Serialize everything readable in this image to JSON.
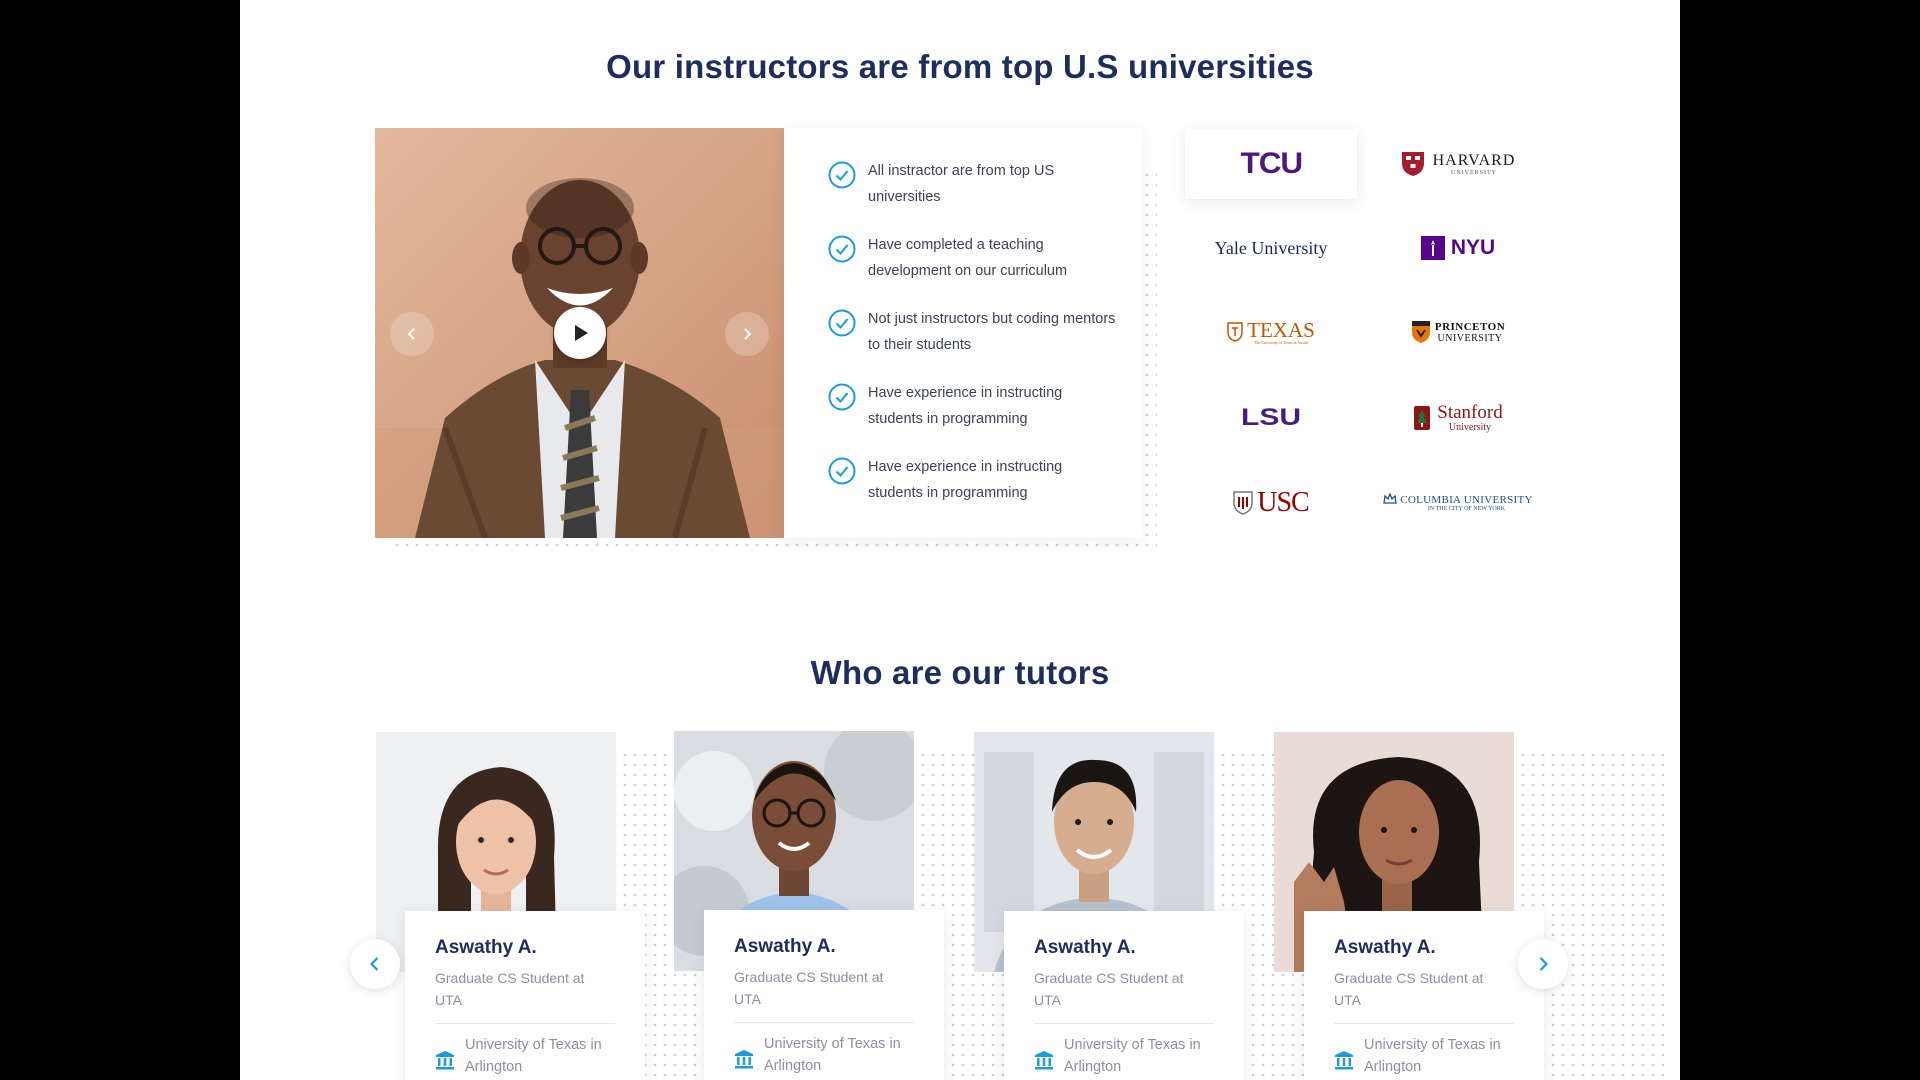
{
  "instructors_section": {
    "title": "Our instructors are from top U.S universities",
    "features": [
      "All instractor are from top US universities",
      "Have completed a teaching development on our curriculum",
      "Not just instructors but coding mentors to their students",
      "Have experience in instructing students in programming",
      "Have experience in instructing students in programming"
    ],
    "universities": [
      {
        "name": "TCU",
        "color": "#4d1979"
      },
      {
        "name": "HARVARD",
        "sub": "UNIVERSITY",
        "color": "#a51c30"
      },
      {
        "name": "Yale University",
        "color": "#0f2a5c"
      },
      {
        "name": "NYU",
        "color": "#57068c"
      },
      {
        "name": "TEXAS",
        "sub": "The University of Texas at Austin",
        "color": "#bf5700"
      },
      {
        "name": "PRINCETON",
        "sub": "UNIVERSITY",
        "color": "#e77500"
      },
      {
        "name": "LSU",
        "color": "#461d7c"
      },
      {
        "name": "Stanford",
        "sub": "University",
        "color": "#8c1515"
      },
      {
        "name": "USC",
        "color": "#990000"
      },
      {
        "name": "COLUMBIA UNIVERSITY",
        "sub": "IN THE CITY OF NEW YORK",
        "color": "#1d4f91"
      }
    ],
    "icons": {
      "play": "play-icon",
      "prev": "chevron-left-icon",
      "next": "chevron-right-icon",
      "check": "check-circle-icon"
    }
  },
  "tutors_section": {
    "title": "Who are our tutors",
    "tutors": [
      {
        "name": "Aswathy A.",
        "role": "Graduate CS Student at UTA",
        "university": "University of Texas in Arlington"
      },
      {
        "name": "Aswathy A.",
        "role": "Graduate CS Student at UTA",
        "university": "University of Texas in Arlington"
      },
      {
        "name": "Aswathy A.",
        "role": "Graduate CS Student at UTA",
        "university": "University of Texas in Arlington"
      },
      {
        "name": "Aswathy A.",
        "role": "Graduate CS Student at UTA",
        "university": "University of Texas in Arlington"
      }
    ],
    "icons": {
      "university": "university-bank-icon",
      "prev": "chevron-left-icon",
      "next": "chevron-right-icon"
    }
  },
  "colors": {
    "heading": "#1f2d5c",
    "accent": "#1e9bd7",
    "muted": "#8a90a0",
    "page_bg": "#000000"
  }
}
